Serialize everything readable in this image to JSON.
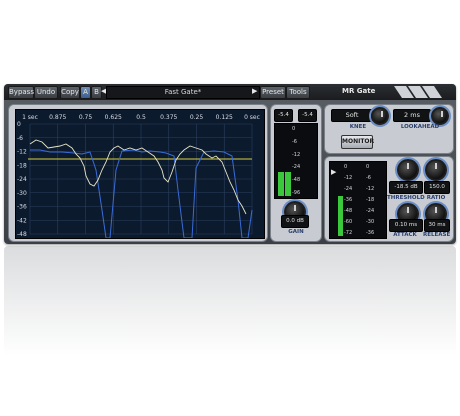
{
  "toolbar": {
    "bypass": "Bypass",
    "undo": "Undo",
    "copy": "Copy",
    "a_btn": "A",
    "b_btn": "B",
    "preset_name": "Fast Gate*",
    "preset": "Preset",
    "tools": "Tools",
    "plugin_name": "MR Gate"
  },
  "graph": {
    "time_labels": [
      "1 sec",
      "0.875",
      "0.75",
      "0.625",
      "0.5",
      "0.375",
      "0.25",
      "0.125",
      "0 sec"
    ],
    "db_labels": [
      "0",
      "-6",
      "-12",
      "-18",
      "-24",
      "-30",
      "-36",
      "-42",
      "-48"
    ]
  },
  "gain_meter": {
    "peak_left": "-5.4",
    "peak_right": "-5.4",
    "scale": [
      "0",
      "-6",
      "-12",
      "-24",
      "-48",
      "-96"
    ],
    "value": "0.0 dB",
    "label": "GAIN",
    "level_left": 0.35,
    "level_right": 0.35
  },
  "controls": {
    "knee_value": "Soft",
    "knee_label": "KNEE",
    "lookahead_value": "2 ms",
    "lookahead_label": "LOOKAHEAD",
    "monitor": "MONITOR",
    "threshold_value": "-18.5 dB",
    "threshold_label": "THRESHOLD",
    "ratio_value": "150.0",
    "ratio_label": "RATIO",
    "attack_value": "0.10 ms",
    "attack_label": "ATTACK",
    "release_value": "30 ms",
    "release_label": "RELEASE",
    "meter_scale_left": [
      "0",
      "-12",
      "-24",
      "-36",
      "-48",
      "-60",
      "-72"
    ],
    "meter_scale_right": [
      "0",
      "-6",
      "-12",
      "-18",
      "-24",
      "-30",
      "-36"
    ],
    "level_left": 0.55,
    "level_right": 0.0
  },
  "colors": {
    "accent": "#6b8ec4",
    "graph_bg": "#0c1a2e",
    "input_line": "#e8e6c8",
    "gate_line": "#3a6cd8",
    "threshold_line": "#d8d040",
    "meter_green": "#3cc83c"
  }
}
